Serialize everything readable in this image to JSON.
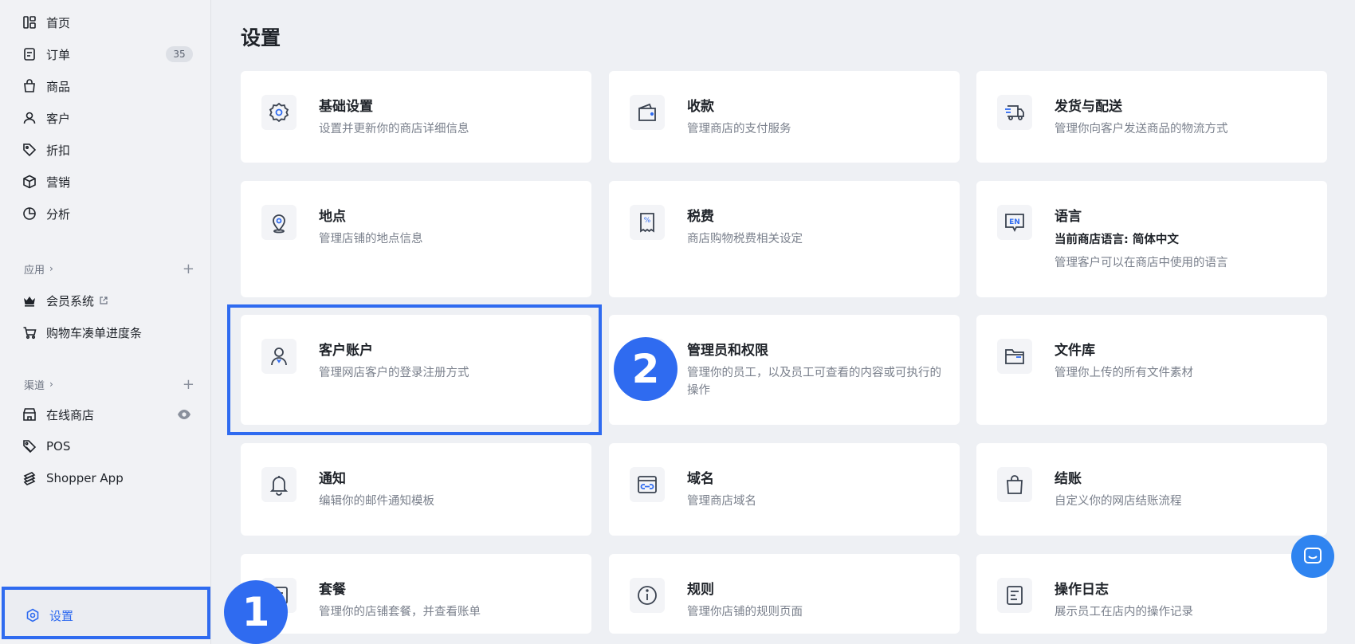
{
  "sidebar": {
    "items": [
      {
        "label": "首页",
        "icon": "dashboard-icon"
      },
      {
        "label": "订单",
        "icon": "order-icon",
        "badge": "35"
      },
      {
        "label": "商品",
        "icon": "product-bag-icon"
      },
      {
        "label": "客户",
        "icon": "user-icon"
      },
      {
        "label": "折扣",
        "icon": "tag-icon"
      },
      {
        "label": "营销",
        "icon": "box-icon"
      },
      {
        "label": "分析",
        "icon": "pie-chart-icon"
      }
    ],
    "apps": {
      "title": "应用",
      "items": [
        {
          "label": "会员系统",
          "icon": "crown-icon"
        },
        {
          "label": "购物车凑单进度条",
          "icon": "cart-icon"
        }
      ]
    },
    "channels": {
      "title": "渠道",
      "items": [
        {
          "label": "在线商店",
          "icon": "store-icon"
        },
        {
          "label": "POS",
          "icon": "pos-tag-icon"
        },
        {
          "label": "Shopper App",
          "icon": "layers-icon"
        }
      ]
    },
    "settings": {
      "label": "设置",
      "icon": "gear-icon"
    }
  },
  "main": {
    "title": "设置",
    "cards": [
      {
        "title": "基础设置",
        "desc": "设置并更新你的商店详细信息",
        "icon": "gear-icon"
      },
      {
        "title": "收款",
        "desc": "管理商店的支付服务",
        "icon": "wallet-icon"
      },
      {
        "title": "发货与配送",
        "desc": "管理你向客户发送商品的物流方式",
        "icon": "truck-icon"
      },
      {
        "title": "地点",
        "desc": "管理店铺的地点信息",
        "icon": "location-pin-icon"
      },
      {
        "title": "税费",
        "desc": "商店购物税费相关设定",
        "icon": "tax-receipt-icon"
      },
      {
        "title": "语言",
        "sub": "当前商店语言: 简体中文",
        "desc": "管理客户可以在商店中使用的语言",
        "icon": "language-en-icon"
      },
      {
        "title": "客户账户",
        "desc": "管理网店客户的登录注册方式",
        "icon": "customer-account-icon"
      },
      {
        "title": "管理员和权限",
        "desc": "管理你的员工，以及员工可查看的内容或可执行的操作",
        "icon": "admin-icon"
      },
      {
        "title": "文件库",
        "desc": "管理你上传的所有文件素材",
        "icon": "folder-icon"
      },
      {
        "title": "通知",
        "desc": "编辑你的邮件通知模板",
        "icon": "bell-icon"
      },
      {
        "title": "域名",
        "desc": "管理商店域名",
        "icon": "domain-link-icon"
      },
      {
        "title": "结账",
        "desc": "自定义你的网店结账流程",
        "icon": "shopping-bag-icon"
      },
      {
        "title": "套餐",
        "desc": "管理你的店铺套餐，并查看账单",
        "icon": "plan-icon"
      },
      {
        "title": "规则",
        "desc": "管理你店铺的规则页面",
        "icon": "info-icon"
      },
      {
        "title": "操作日志",
        "desc": "展示员工在店内的操作记录",
        "icon": "log-icon"
      }
    ]
  },
  "annotations": {
    "marker1": "1",
    "marker2": "2"
  },
  "colors": {
    "accent": "#2f6bf0",
    "chat": "#2f84f0"
  }
}
